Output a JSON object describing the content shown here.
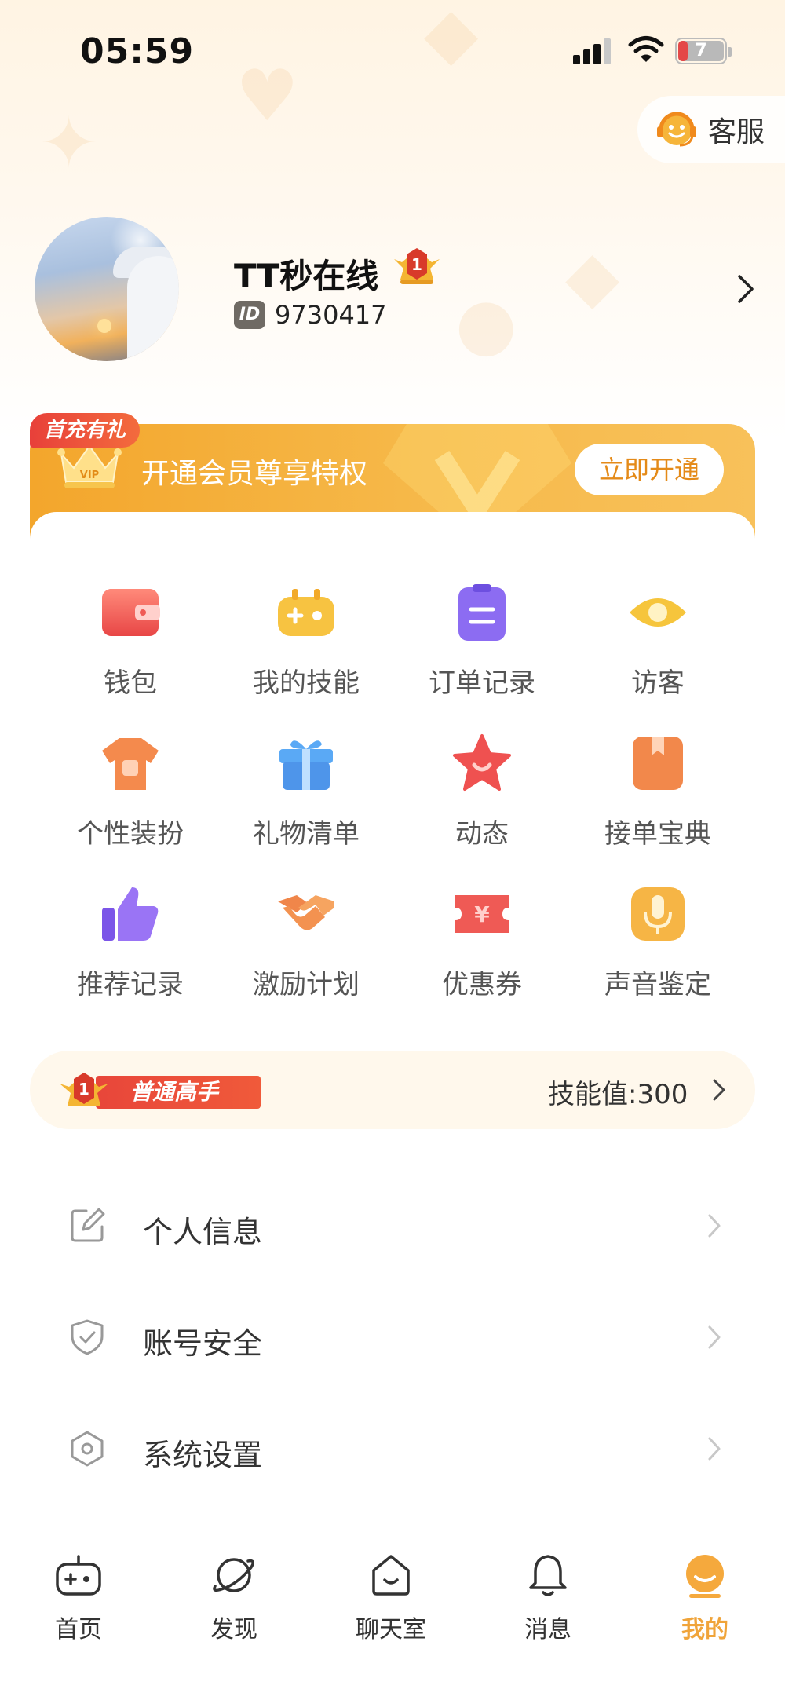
{
  "status_bar": {
    "time": "05:59",
    "battery_level": "7"
  },
  "header": {
    "service_label": "客服",
    "service_icon": "headset-smiley-icon"
  },
  "profile": {
    "name": "TT秒在线",
    "id_label": "ID",
    "id_value": "9730417",
    "level_badge_number": "1"
  },
  "vip_banner": {
    "tag": "首充有礼",
    "text": "开通会员尊享特权",
    "button_label": "立即开通",
    "crown_text": "VIP"
  },
  "grid": [
    {
      "label": "钱包",
      "icon": "wallet-icon"
    },
    {
      "label": "我的技能",
      "icon": "gamepad-icon"
    },
    {
      "label": "订单记录",
      "icon": "clipboard-icon"
    },
    {
      "label": "访客",
      "icon": "eye-icon"
    },
    {
      "label": "个性装扮",
      "icon": "tshirt-icon"
    },
    {
      "label": "礼物清单",
      "icon": "gift-icon"
    },
    {
      "label": "动态",
      "icon": "star-icon"
    },
    {
      "label": "接单宝典",
      "icon": "book-icon"
    },
    {
      "label": "推荐记录",
      "icon": "thumbs-up-icon"
    },
    {
      "label": "激励计划",
      "icon": "handshake-icon"
    },
    {
      "label": "优惠券",
      "icon": "coupon-icon"
    },
    {
      "label": "声音鉴定",
      "icon": "microphone-icon"
    }
  ],
  "skill": {
    "level_label": "普通高手",
    "value_text": "技能值:300",
    "badge_number": "1"
  },
  "settings": [
    {
      "label": "个人信息",
      "icon": "edit-icon"
    },
    {
      "label": "账号安全",
      "icon": "shield-check-icon"
    },
    {
      "label": "系统设置",
      "icon": "hexagon-settings-icon"
    }
  ],
  "tabs": [
    {
      "label": "首页",
      "icon": "gamepad-tab-icon",
      "active": false
    },
    {
      "label": "发现",
      "icon": "planet-icon",
      "active": false
    },
    {
      "label": "聊天室",
      "icon": "chat-house-icon",
      "active": false
    },
    {
      "label": "消息",
      "icon": "bell-icon",
      "active": false
    },
    {
      "label": "我的",
      "icon": "profile-face-icon",
      "active": true
    }
  ],
  "colors": {
    "accent": "#f0a43a",
    "vip_orange": "#f3a62c",
    "first_charge_red": "#e8403a",
    "skill_tag_red": "#e8463a"
  }
}
